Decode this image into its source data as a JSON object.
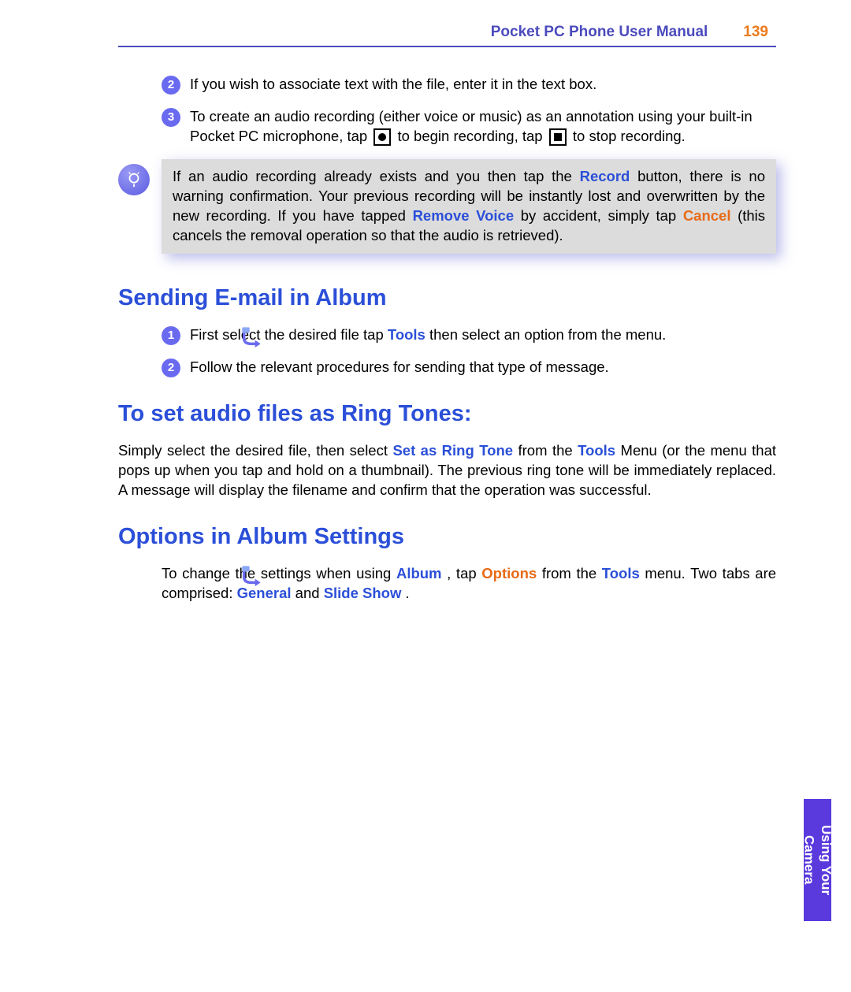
{
  "header": {
    "manual_title": "Pocket PC Phone User Manual",
    "page_number": "139"
  },
  "top_steps": {
    "s2_num": "2",
    "s2_text": "If you wish to associate text with the file, enter it in the text box.",
    "s3_num": "3",
    "s3_a": "To create an audio recording (either voice or music) as an annotation using your built-in Pocket PC microphone, tap ",
    "s3_b": " to begin recording, tap ",
    "s3_c": " to stop recording."
  },
  "tip": {
    "a": "If an audio recording already exists and you then tap the ",
    "record": "Record",
    "b": " button, there is no warning confirmation. Your previous recording will be instantly lost and overwritten by the new recording. If you have tapped ",
    "remove_voice": "Remove Voice",
    "c": " by accident, simply tap ",
    "cancel": "Cancel",
    "d": " (this cancels the removal operation so that the audio is retrieved)."
  },
  "sec_email": {
    "title": "Sending E-mail in Album",
    "s1_num": "1",
    "s1_a": "First select the desired file tap ",
    "s1_tools": "Tools",
    "s1_b": "  then select an option from the menu.",
    "s2_num": "2",
    "s2_text": "Follow the relevant procedures for sending that type of message."
  },
  "sec_ring": {
    "title": "To set audio files as Ring Tones:",
    "a": "Simply select the desired file, then select ",
    "set_ring": "Set as Ring Tone",
    "b": " from the ",
    "tools": "Tools",
    "c": " Menu (or the menu that pops up when you tap and hold on a thumbnail). The previous ring tone will be immediately replaced.  A message will display the filename and confirm that the operation was successful."
  },
  "sec_options": {
    "title": "Options in Album Settings",
    "a": "To change the settings when using ",
    "album": "Album",
    "b": ", tap ",
    "options": "Options",
    "c": " from the ",
    "tools": "Tools",
    "d": " menu. Two tabs are comprised: ",
    "general": "General",
    "e": " and ",
    "slideshow": "Slide Show",
    "f": "."
  },
  "side_tab": "Using Your Camera"
}
